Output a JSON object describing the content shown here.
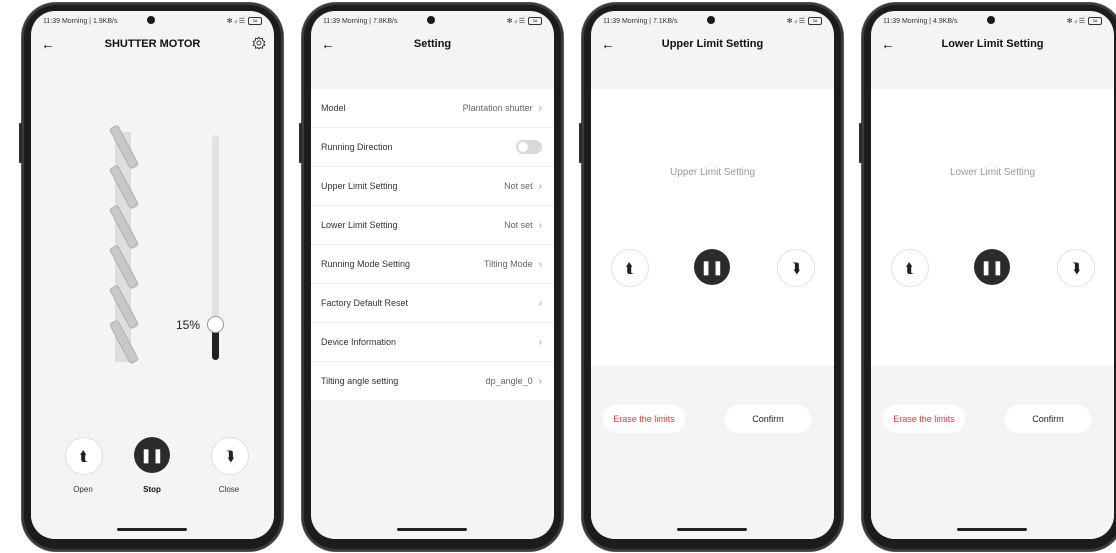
{
  "screens": [
    {
      "status": {
        "time": "11:39 Morning | 1.9KB/s",
        "icons": "✻ ᵢₗ ☰",
        "battery": "58"
      },
      "title": "SHUTTER MOTOR",
      "position_percent_label": "15%",
      "position_fraction": 0.15,
      "controls": {
        "open": "Open",
        "stop": "Stop",
        "close": "Close"
      },
      "icons": {
        "back": "back-arrow-icon",
        "settings": "gear-icon",
        "open": "arrow-up-icon",
        "stop": "pause-icon",
        "close": "arrow-down-icon"
      }
    },
    {
      "status": {
        "time": "11:39 Morning | 7.8KB/s",
        "icons": "✻ ᵢₗ ☰",
        "battery": "58"
      },
      "title": "Setting",
      "rows": [
        {
          "label": "Model",
          "value": "Plantation shutter"
        },
        {
          "label": "Running Direction",
          "value": ""
        },
        {
          "label": "Upper Limit Setting",
          "value": "Not set"
        },
        {
          "label": "Lower Limit Setting",
          "value": "Not set"
        },
        {
          "label": "Running Mode Setting",
          "value": "Tilting Mode"
        },
        {
          "label": "Factory Default Reset",
          "value": ""
        },
        {
          "label": "Device Information",
          "value": ""
        },
        {
          "label": "Tilting angle setting",
          "value": "dp_angle_0"
        }
      ]
    },
    {
      "status": {
        "time": "11:39 Morning | 7.1KB/s",
        "icons": "✻ ᵢₗ ☰",
        "battery": "58"
      },
      "title": "Upper Limit Setting",
      "body_title": "Upper Limit Setting",
      "erase": "Erase the limits",
      "confirm": "Confirm"
    },
    {
      "status": {
        "time": "11:39 Morning | 4.9KB/s",
        "icons": "✻ ᵢₗ ☰",
        "battery": "58"
      },
      "title": "Lower Limit Setting",
      "body_title": "Lower Limit Setting",
      "erase": "Erase the limits",
      "confirm": "Confirm"
    }
  ],
  "colors": {
    "accent_red": "#d23a3a",
    "dark_button": "#2b2b2b",
    "screen_bg": "#f4f4f4"
  }
}
